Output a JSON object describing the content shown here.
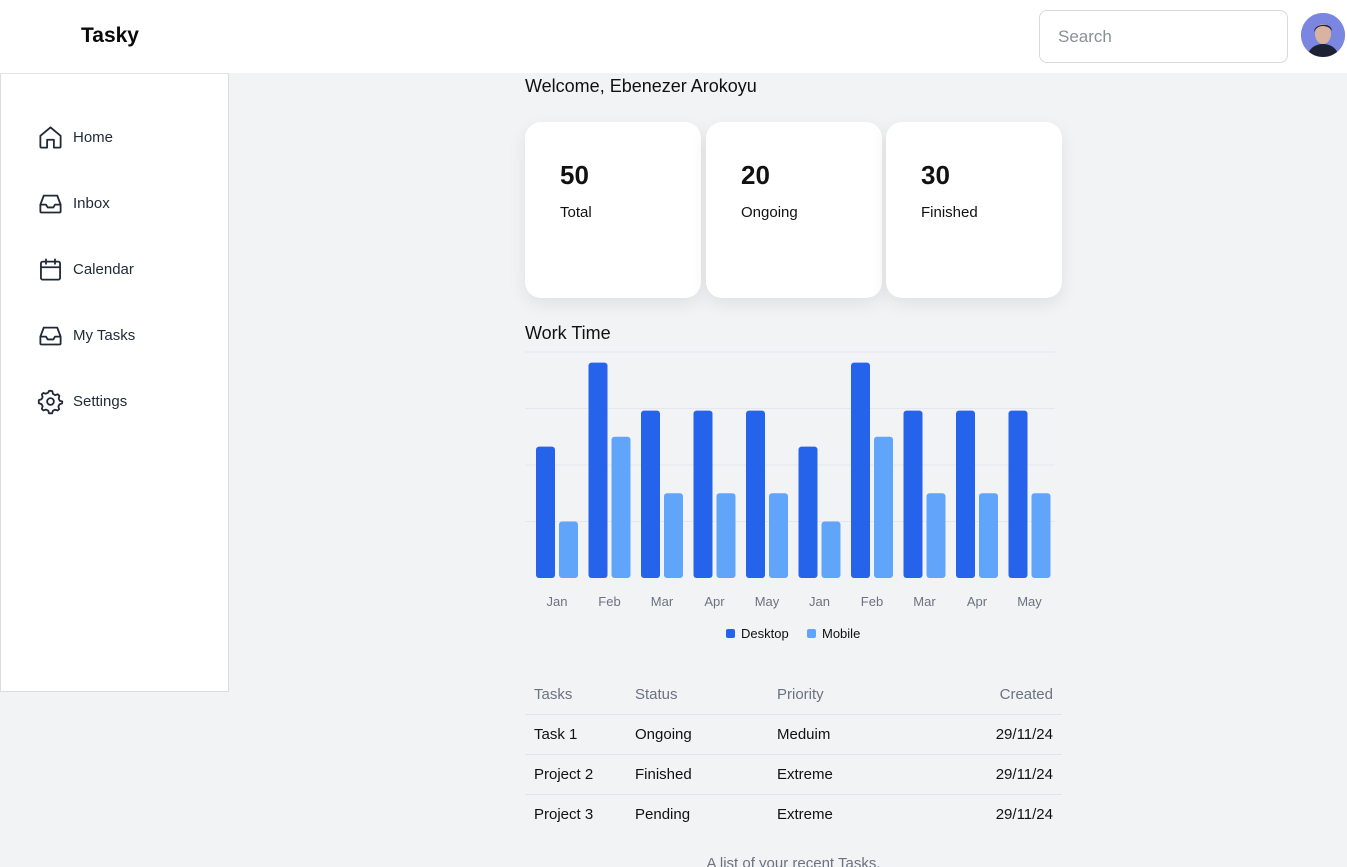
{
  "app": {
    "title": "Tasky"
  },
  "search": {
    "placeholder": "Search"
  },
  "sidebar": {
    "items": [
      {
        "label": "Home",
        "icon": "home-icon"
      },
      {
        "label": "Inbox",
        "icon": "inbox-icon"
      },
      {
        "label": "Calendar",
        "icon": "calendar-icon"
      },
      {
        "label": "My Tasks",
        "icon": "inbox-tray-icon"
      },
      {
        "label": "Settings",
        "icon": "gear-icon"
      }
    ]
  },
  "main": {
    "welcome": "Welcome, Ebenezer Arokoyu",
    "stats": [
      {
        "value": "50",
        "label": "Total"
      },
      {
        "value": "20",
        "label": "Ongoing"
      },
      {
        "value": "30",
        "label": "Finished"
      }
    ],
    "chart_title": "Work Time"
  },
  "chart_data": {
    "type": "bar",
    "title": "Work Time",
    "categories": [
      "Jan",
      "Feb",
      "Mar",
      "Apr",
      "May",
      "Jan",
      "Feb",
      "Mar",
      "Apr",
      "May"
    ],
    "series": [
      {
        "name": "Desktop",
        "color": "#2563eb",
        "values": [
          186,
          305,
          237,
          237,
          237,
          186,
          305,
          237,
          237,
          237
        ]
      },
      {
        "name": "Mobile",
        "color": "#60a5fa",
        "values": [
          80,
          200,
          120,
          120,
          120,
          80,
          200,
          120,
          120,
          120
        ]
      }
    ],
    "ylim": [
      0,
      320
    ],
    "grid": true,
    "legend": "bottom-center"
  },
  "tasks_table": {
    "headers": [
      "Tasks",
      "Status",
      "Priority",
      "Created"
    ],
    "rows": [
      [
        "Task 1",
        "Ongoing",
        "Meduim",
        "29/11/24"
      ],
      [
        "Project 2",
        "Finished",
        "Extreme",
        "29/11/24"
      ],
      [
        "Project 3",
        "Pending",
        "Extreme",
        "29/11/24"
      ]
    ],
    "caption": "A list of your recent Tasks."
  }
}
